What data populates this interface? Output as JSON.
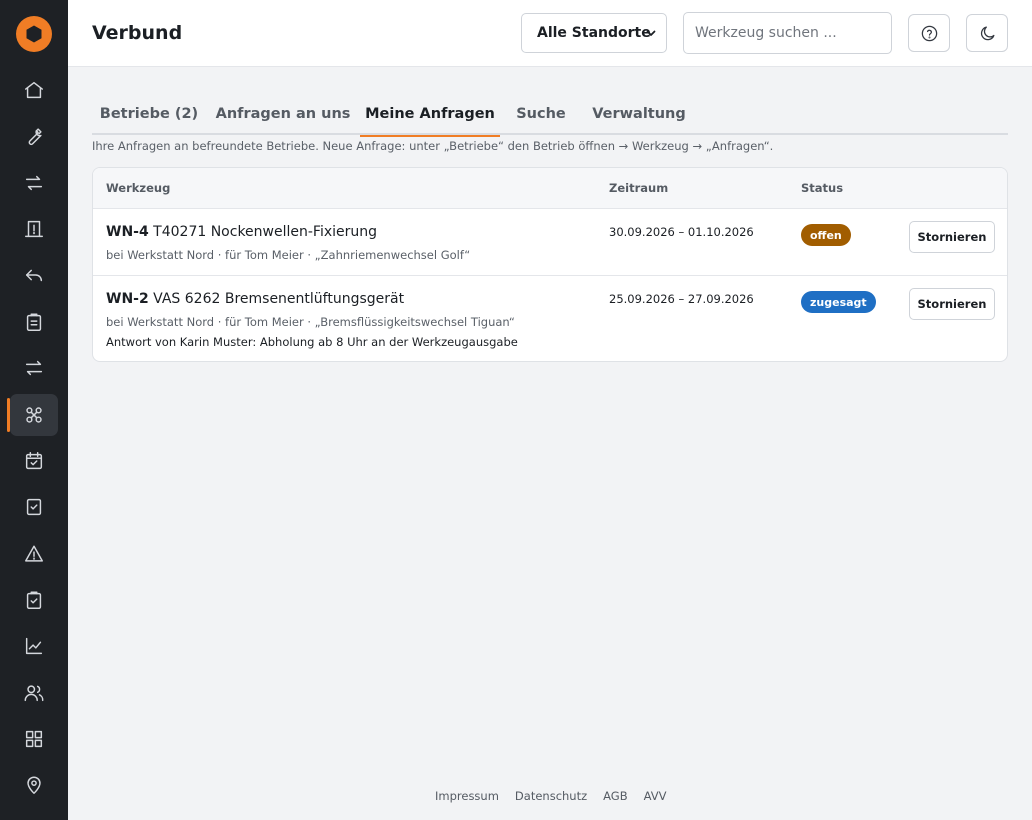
{
  "header": {
    "title": "Verbund",
    "location_select": "Alle Standorte",
    "search_placeholder": "Werkzeug suchen ..."
  },
  "sidebar": {
    "items": [
      {
        "icon": "home-icon"
      },
      {
        "icon": "wrench-icon"
      },
      {
        "icon": "swap-icon"
      },
      {
        "icon": "receipt-icon"
      },
      {
        "icon": "return-icon"
      },
      {
        "icon": "clipboard-icon"
      },
      {
        "icon": "transfer-icon"
      },
      {
        "icon": "network-icon",
        "active": true
      },
      {
        "icon": "calendar-check-icon"
      },
      {
        "icon": "checkbox-icon"
      },
      {
        "icon": "warning-icon"
      },
      {
        "icon": "clipboard-check-icon"
      },
      {
        "icon": "chart-icon"
      },
      {
        "icon": "users-icon"
      },
      {
        "icon": "grid-icon"
      },
      {
        "icon": "location-pin-icon"
      }
    ]
  },
  "tabs": [
    {
      "label": "Betriebe (2)"
    },
    {
      "label": "Anfragen an uns"
    },
    {
      "label": "Meine Anfragen",
      "active": true
    },
    {
      "label": "Suche"
    },
    {
      "label": "Verwaltung"
    }
  ],
  "hint": "Ihre Anfragen an befreundete Betriebe. Neue Anfrage: unter „Betriebe“ den Betrieb öffnen → Werkzeug → „Anfragen“.",
  "table": {
    "columns": [
      "Werkzeug",
      "Zeitraum",
      "Status"
    ],
    "rows": [
      {
        "code": "WN-4",
        "name": "T40271 Nockenwellen-Fixierung",
        "meta": "bei Werkstatt Nord · für Tom Meier · „Zahnriemenwechsel Golf“",
        "answer": "",
        "period": "30.09.2026 – 01.10.2026",
        "status": "offen",
        "status_color": "#a15d00",
        "action": "Stornieren"
      },
      {
        "code": "WN-2",
        "name": "VAS 6262 Bremsenentlüftungsgerät",
        "meta": "bei Werkstatt Nord · für Tom Meier · „Bremsflüssigkeitswechsel Tiguan“",
        "answer": "Antwort von Karin Muster: Abholung ab 8 Uhr an der Werkzeugausgabe",
        "period": "25.09.2026 – 27.09.2026",
        "status": "zugesagt",
        "status_color": "#1f6fc4",
        "action": "Stornieren"
      }
    ]
  },
  "footer": {
    "links": [
      "Impressum",
      "Datenschutz",
      "AGB",
      "AVV"
    ]
  },
  "colors": {
    "accent": "#f07d25",
    "sidebar": "#1e2125"
  }
}
